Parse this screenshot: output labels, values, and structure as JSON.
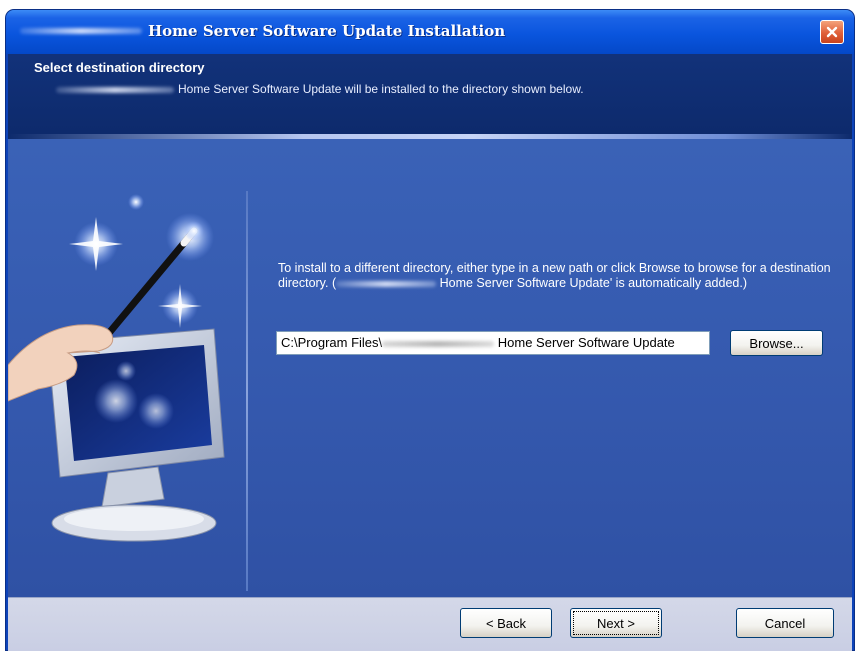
{
  "window": {
    "title": "Home Server Software Update Installation"
  },
  "header": {
    "title": "Select destination directory",
    "subtitle": "Home Server Software Update will be installed to the directory shown below."
  },
  "main": {
    "instructions_part1": "To install to a different directory, either type in a new path or click Browse to browse for a destination directory. (",
    "instructions_part2": " Home Server Software Update' is automatically added.)",
    "path_prefix": "C:\\Program Files\\",
    "path_suffix": " Home Server Software Update",
    "browse_label": "Browse..."
  },
  "footer": {
    "back_label": "< Back",
    "next_label": "Next >",
    "cancel_label": "Cancel"
  },
  "icons": [
    "close-icon",
    "magic-wand-icon",
    "monitor-icon",
    "sparkle-icon"
  ],
  "colors": {
    "title_bar": "#0a55de",
    "header": "#0d2a6c",
    "content": "#3458ad",
    "close_button": "#e0603a",
    "footer": "#d4d8e8"
  }
}
